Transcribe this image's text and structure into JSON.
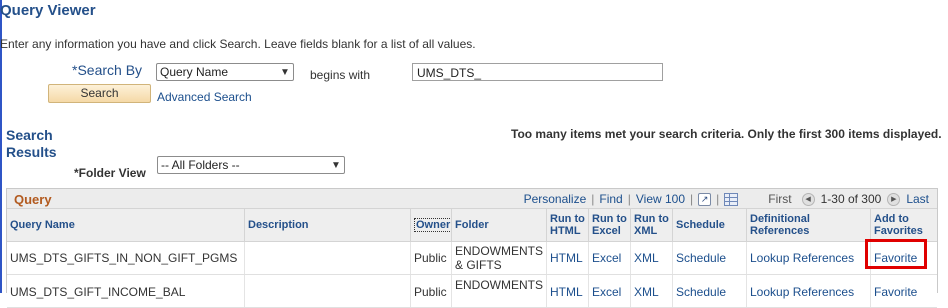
{
  "page": {
    "title": "Query Viewer",
    "instructions": "Enter any information you have and click Search. Leave fields blank for a list of all values."
  },
  "search": {
    "search_by_label": "*Search By",
    "search_by_value": "Query Name",
    "operator_text": "begins with",
    "query_value": "UMS_DTS_",
    "search_button": "Search",
    "advanced_link": "Advanced Search"
  },
  "results": {
    "title_line1": "Search",
    "title_line2": "Results",
    "notice": "Too many items met your search criteria. Only the first 300 items displayed.",
    "folder_label": "*Folder View",
    "folder_value": "-- All Folders --"
  },
  "grid": {
    "caption": "Query",
    "personalize": "Personalize",
    "find": "Find",
    "view100": "View 100",
    "first": "First",
    "range": "1-30 of 300",
    "last": "Last",
    "columns": {
      "query_name": "Query Name",
      "description": "Description",
      "owner": "Owner",
      "folder": "Folder",
      "run_html_1": "Run to",
      "run_html_2": "HTML",
      "run_excel_1": "Run to",
      "run_excel_2": "Excel",
      "run_xml_1": "Run to",
      "run_xml_2": "XML",
      "schedule": "Schedule",
      "def_refs": "Definitional References",
      "fav_1": "Add to",
      "fav_2": "Favorites"
    },
    "rows": [
      {
        "name": "UMS_DTS_GIFTS_IN_NON_GIFT_PGMS",
        "description": "",
        "owner": "Public",
        "folder_1": "ENDOWMENTS",
        "folder_2": "& GIFTS",
        "html": "HTML",
        "excel": "Excel",
        "xml": "XML",
        "schedule": "Schedule",
        "refs": "Lookup References",
        "favorite": "Favorite"
      },
      {
        "name": "UMS_DTS_GIFT_INCOME_BAL",
        "description": "",
        "owner": "Public",
        "folder_1": "ENDOWMENTS",
        "folder_2": "",
        "html": "HTML",
        "excel": "Excel",
        "xml": "XML",
        "schedule": "Schedule",
        "refs": "Lookup References",
        "favorite": "Favorite"
      }
    ]
  },
  "colors": {
    "accent_blue": "#24508a",
    "link_blue": "#1c4f8d",
    "caption_orange": "#b25a1f",
    "highlight_red": "#e00000"
  }
}
